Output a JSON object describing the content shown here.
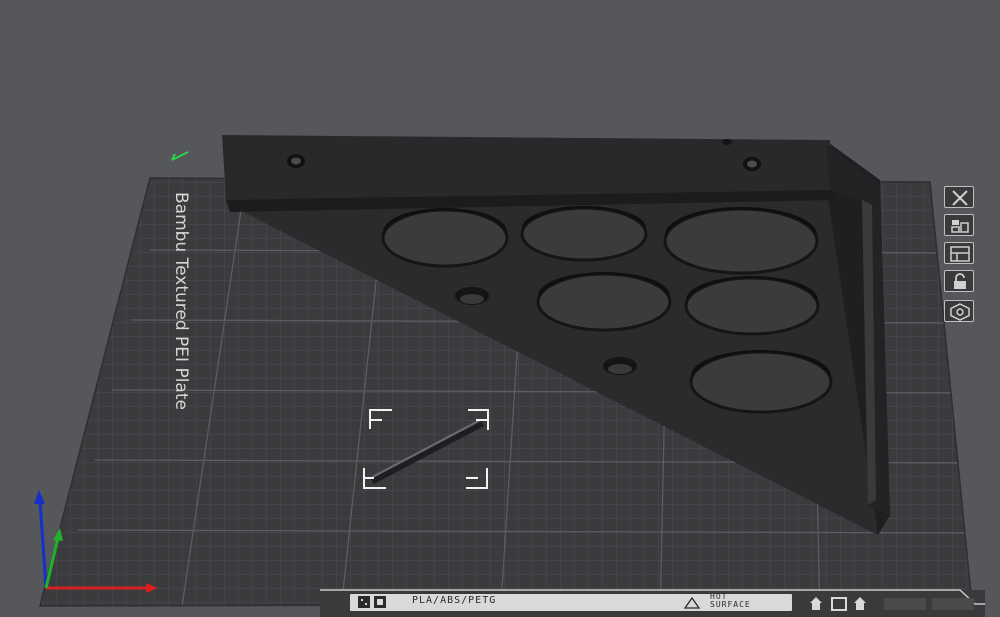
{
  "viewport": {
    "background": "#56575b",
    "bed_color": "#3b3b3e",
    "model_color": "#2b2b2d"
  },
  "plate": {
    "name": "Bambu Textured PEI Plate",
    "material_label": "PLA/ABS/PETG",
    "warning_label_line1": "HOT",
    "warning_label_line2": "SURFACE"
  },
  "side_controls": [
    {
      "name": "close",
      "icon": "close-icon"
    },
    {
      "name": "arrange",
      "icon": "arrange-icon"
    },
    {
      "name": "layout",
      "icon": "layout-icon"
    },
    {
      "name": "lock",
      "icon": "lock-icon"
    },
    {
      "name": "settings",
      "icon": "gear-icon"
    }
  ],
  "axes": {
    "x_color": "#d42020",
    "y_color": "#1fb32a",
    "z_color": "#1530c8"
  }
}
